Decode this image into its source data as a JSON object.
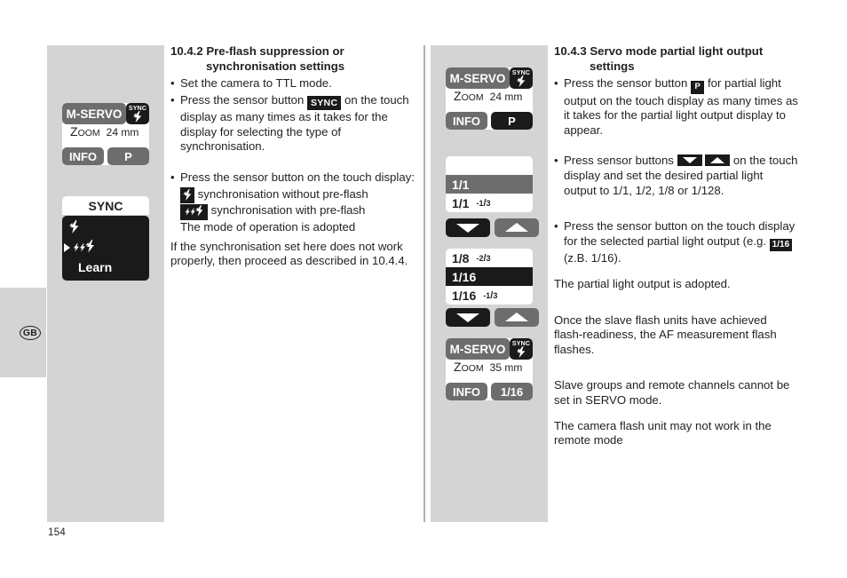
{
  "page": {
    "number": "154",
    "language_tab": "GB"
  },
  "left_section": {
    "heading_line1": "10.4.2 Pre-flash suppression or",
    "heading_line2": "synchronisation settings",
    "bullet1": "Set the camera to TTL mode.",
    "bullet2_before": "Press the sensor button",
    "bullet2_badge": "SYNC",
    "bullet2_after": "on the touch display as many times as it takes for the display for selecting the type of synchronisation.",
    "bullet3": "Press the sensor button on the touch display:",
    "option1_icon": "flash-bolt-icon",
    "option1_text": "synchronisation without pre-flash",
    "option2_icon": "triple-flash-bolt-icon",
    "option2_text": "synchronisation with pre-flash",
    "option_note": "The mode of operation is adopted",
    "closing": "If the synchronisation set here does not work properly, then proceed as described in 10.4.4."
  },
  "right_section": {
    "heading_line1": "10.4.3 Servo mode partial light output",
    "heading_line2": "settings",
    "bullet1_before": "Press the sensor button",
    "bullet1_badge": "P",
    "bullet1_after": "for partial light output on the touch display as many times as it takes for the partial light output display to appear.",
    "bullet2_before": "Press sensor buttons",
    "bullet2_icon_down": "arrow-down-icon",
    "bullet2_icon_up": "arrow-up-icon",
    "bullet2_after": "on the touch display and set the desired partial light output to 1/1, 1/2, 1/8 or 1/128.",
    "bullet3_before": "Press the sensor button on the touch display for the selected partial light output (e.g.",
    "bullet3_badge": "1/16",
    "bullet3_after": "(z.B. 1/16).",
    "para1": "The partial light output is adopted.",
    "para2": "Once the slave flash units have achieved flash-readiness, the AF measurement flash flashes.",
    "para3": "Slave groups and remote channels cannot be set in SERVO mode.",
    "para4": "The camera flash unit may not work in the remote mode"
  },
  "figures_left": {
    "panel1": {
      "mode_key": "M-SERVO",
      "sync_key_label": "SYNC",
      "sync_key_icon": "flash-bolt-icon",
      "zoom_label": "Zoom",
      "zoom_value": "24 mm",
      "info_key": "INFO",
      "mode_p_key": "P"
    },
    "panel2": {
      "title": "SYNC",
      "items": [
        {
          "label": "",
          "icon": "flash-bolt-icon",
          "selected": false
        },
        {
          "label": "",
          "icon": "triple-flash-bolt-icon",
          "selected": true
        },
        {
          "label": "Learn",
          "icon": "",
          "selected": false
        }
      ]
    }
  },
  "figures_right": {
    "panel1": {
      "mode_key": "M-SERVO",
      "sync_key_label": "SYNC",
      "sync_key_icon": "flash-bolt-icon",
      "zoom_label": "Zoom",
      "zoom_value": "24 mm",
      "info_key": "INFO",
      "mode_p_key": "P"
    },
    "panel2": {
      "rows": [
        {
          "main": "",
          "sup": "",
          "sub": "",
          "state": "blank"
        },
        {
          "main": "1/1",
          "sup": "",
          "sub": "",
          "state": "sel-grey"
        },
        {
          "main": "1/1",
          "sup": "-1",
          "sub": "3",
          "state": "normal"
        }
      ],
      "arrow_down": "arrow-down-icon",
      "arrow_up": "arrow-up-icon"
    },
    "panel3": {
      "rows": [
        {
          "main": "1/8",
          "sup": "-2",
          "sub": "3",
          "state": "normal"
        },
        {
          "main": "1/16",
          "sup": "",
          "sub": "",
          "state": "sel-dark"
        },
        {
          "main": "1/16",
          "sup": "-1",
          "sub": "3",
          "state": "normal"
        }
      ],
      "arrow_down": "arrow-down-icon",
      "arrow_up": "arrow-up-icon"
    },
    "panel4": {
      "mode_key": "M-SERVO",
      "sync_key_label": "SYNC",
      "sync_key_icon": "flash-bolt-icon",
      "zoom_label": "Zoom",
      "zoom_value": "35 mm",
      "info_key": "INFO",
      "mode_p_key": "1/16"
    }
  },
  "colors": {
    "figure_background": "#d4d4d4",
    "key_grey": "#6d6d6d",
    "key_dark": "#1a1a1a",
    "text": "#231f20",
    "divider": "#b0b0b0"
  }
}
